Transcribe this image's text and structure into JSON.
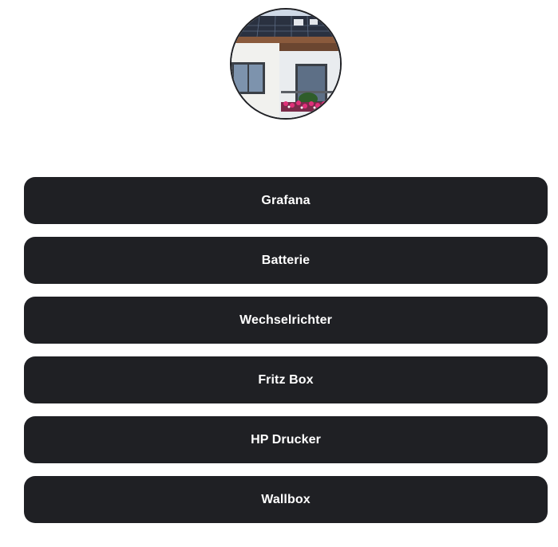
{
  "profile": {
    "avatar_description_icon": "house-photo-icon"
  },
  "links": [
    {
      "label": "Grafana"
    },
    {
      "label": "Batterie"
    },
    {
      "label": "Wechselrichter"
    },
    {
      "label": "Fritz Box"
    },
    {
      "label": "HP Drucker"
    },
    {
      "label": "Wallbox"
    }
  ],
  "colors": {
    "button_bg": "#1f2024",
    "button_text": "#ffffff",
    "page_bg": "#ffffff"
  }
}
